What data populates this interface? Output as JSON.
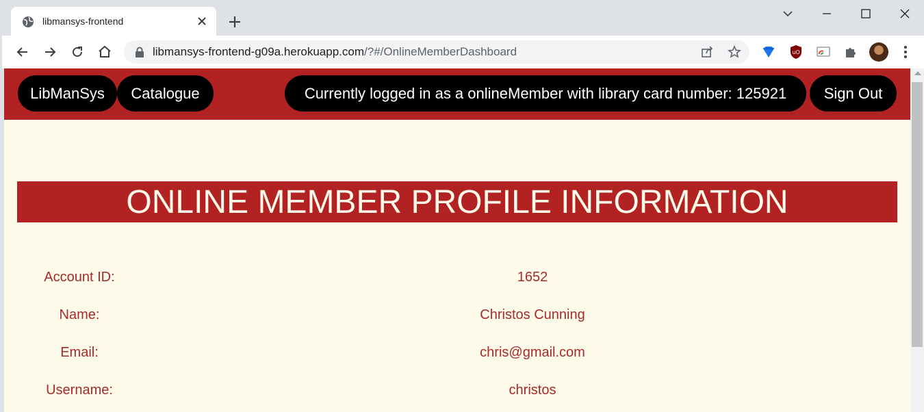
{
  "browser": {
    "tab_title": "libmansys-frontend",
    "url_host": "libmansys-frontend-g09a.herokuapp.com",
    "url_path": "/?#/OnlineMemberDashboard"
  },
  "navbar": {
    "brand_label": "LibManSys",
    "catalogue_label": "Catalogue",
    "status_text": "Currently logged in as a onlineMember with library card number: 125921",
    "signout_label": "Sign Out"
  },
  "page": {
    "heading": "ONLINE MEMBER PROFILE INFORMATION",
    "rows": [
      {
        "label": "Account ID:",
        "value": "1652"
      },
      {
        "label": "Name:",
        "value": "Christos Cunning"
      },
      {
        "label": "Email:",
        "value": "chris@gmail.com"
      },
      {
        "label": "Username:",
        "value": "christos"
      }
    ]
  },
  "colors": {
    "accent": "#b22222",
    "page_bg": "#fefbea",
    "pill_bg": "#000000",
    "text": "#a52a2a"
  }
}
